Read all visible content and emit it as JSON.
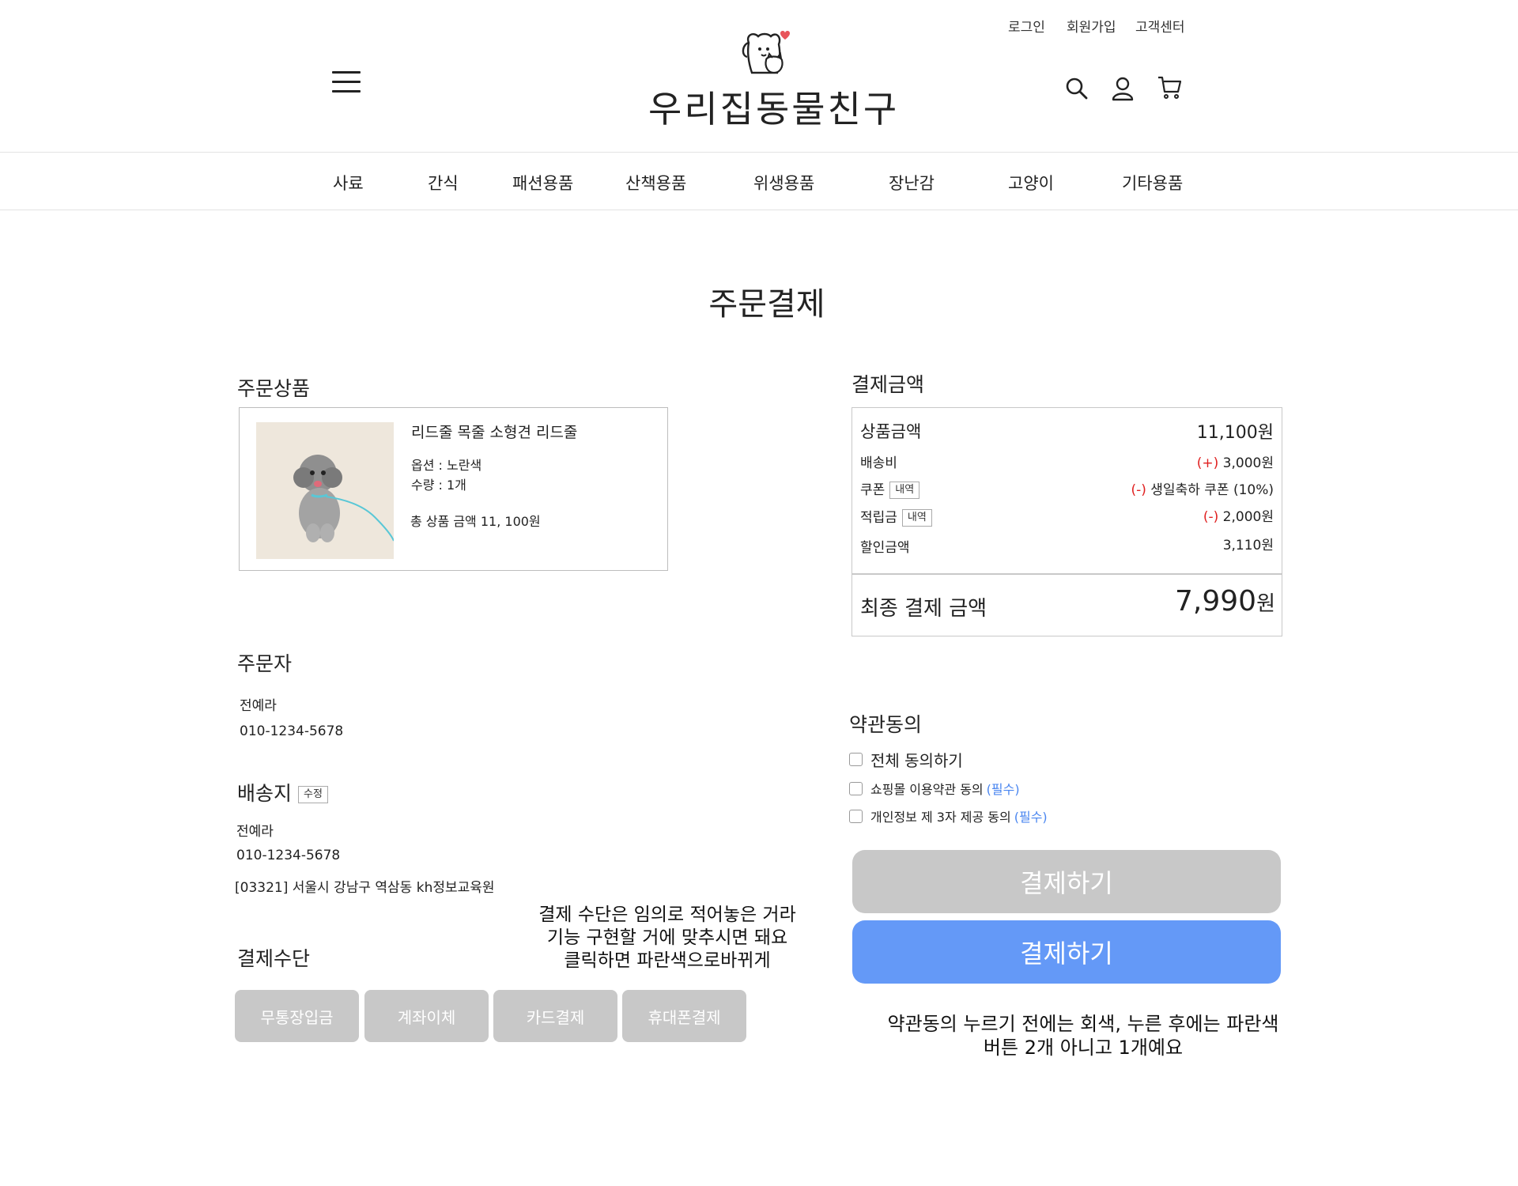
{
  "util_links": [
    "로그인",
    "회원가입",
    "고객센터"
  ],
  "logo_text": "우리집동물친구",
  "icons": {
    "menu": "hamburger-icon",
    "search": "search-icon",
    "user": "user-icon",
    "cart": "cart-icon"
  },
  "nav": [
    "사료",
    "간식",
    "패션용품",
    "산책용품",
    "위생용품",
    "장난감",
    "고양이",
    "기타용품"
  ],
  "page_title": "주문결제",
  "order_product": {
    "section_title": "주문상품",
    "name": "리드줄 목줄 소형견 리드줄",
    "option": "옵션 : 노란색",
    "quantity": "수량 : 1개",
    "total": "총 상품 금액 11, 100원"
  },
  "orderer": {
    "section_title": "주문자",
    "name": "전예라",
    "phone": "010-1234-5678"
  },
  "shipping": {
    "section_title": "배송지",
    "edit_label": "수정",
    "name": "전예라",
    "phone": "010-1234-5678",
    "address": "[03321] 서울시 강남구 역삼동 kh정보교육원"
  },
  "payment_method": {
    "section_title": "결제수단",
    "options": [
      "무통장입금",
      "계좌이체",
      "카드결제",
      "휴대폰결제"
    ],
    "note": "결제 수단은 임의로 적어놓은 거라\n기능 구현할 거에 맞추시면 돼요\n클릭하면 파란색으로바뀌게"
  },
  "payment_amount": {
    "section_title": "결제금액",
    "product_label": "상품금액",
    "product_value": "11,100원",
    "shipping_label": "배송비",
    "shipping_sign": "(+)",
    "shipping_value": " 3,000원",
    "coupon_label": "쿠폰",
    "coupon_tag": "내역",
    "coupon_sign": "(-)",
    "coupon_value": " 생일축하 쿠폰 (10%)",
    "points_label": "적립금",
    "points_tag": "내역",
    "points_sign": "(-)",
    "points_value": " 2,000원",
    "discount_label": "할인금액",
    "discount_value": "3,110원",
    "final_label": "최종 결제 금액",
    "final_value": "7,990",
    "final_unit": "원"
  },
  "terms": {
    "section_title": "약관동의",
    "all": "전체 동의하기",
    "item1": "쇼핑몰 이용약관 동의 ",
    "item1_req": "(필수)",
    "item2": "개인정보 제 3자 제공 동의 ",
    "item2_req": "(필수)"
  },
  "pay_button_label": "결제하기",
  "pay_button_label_active": "결제하기",
  "pay_note": "약관동의 누르기 전에는 회색, 누른 후에는 파란색\n버튼 2개 아니고 1개예요",
  "colors": {
    "accent_blue": "#6499f7",
    "disabled_gray": "#c8c8c8",
    "red": "#e02020",
    "required_blue": "#4a86f0"
  }
}
